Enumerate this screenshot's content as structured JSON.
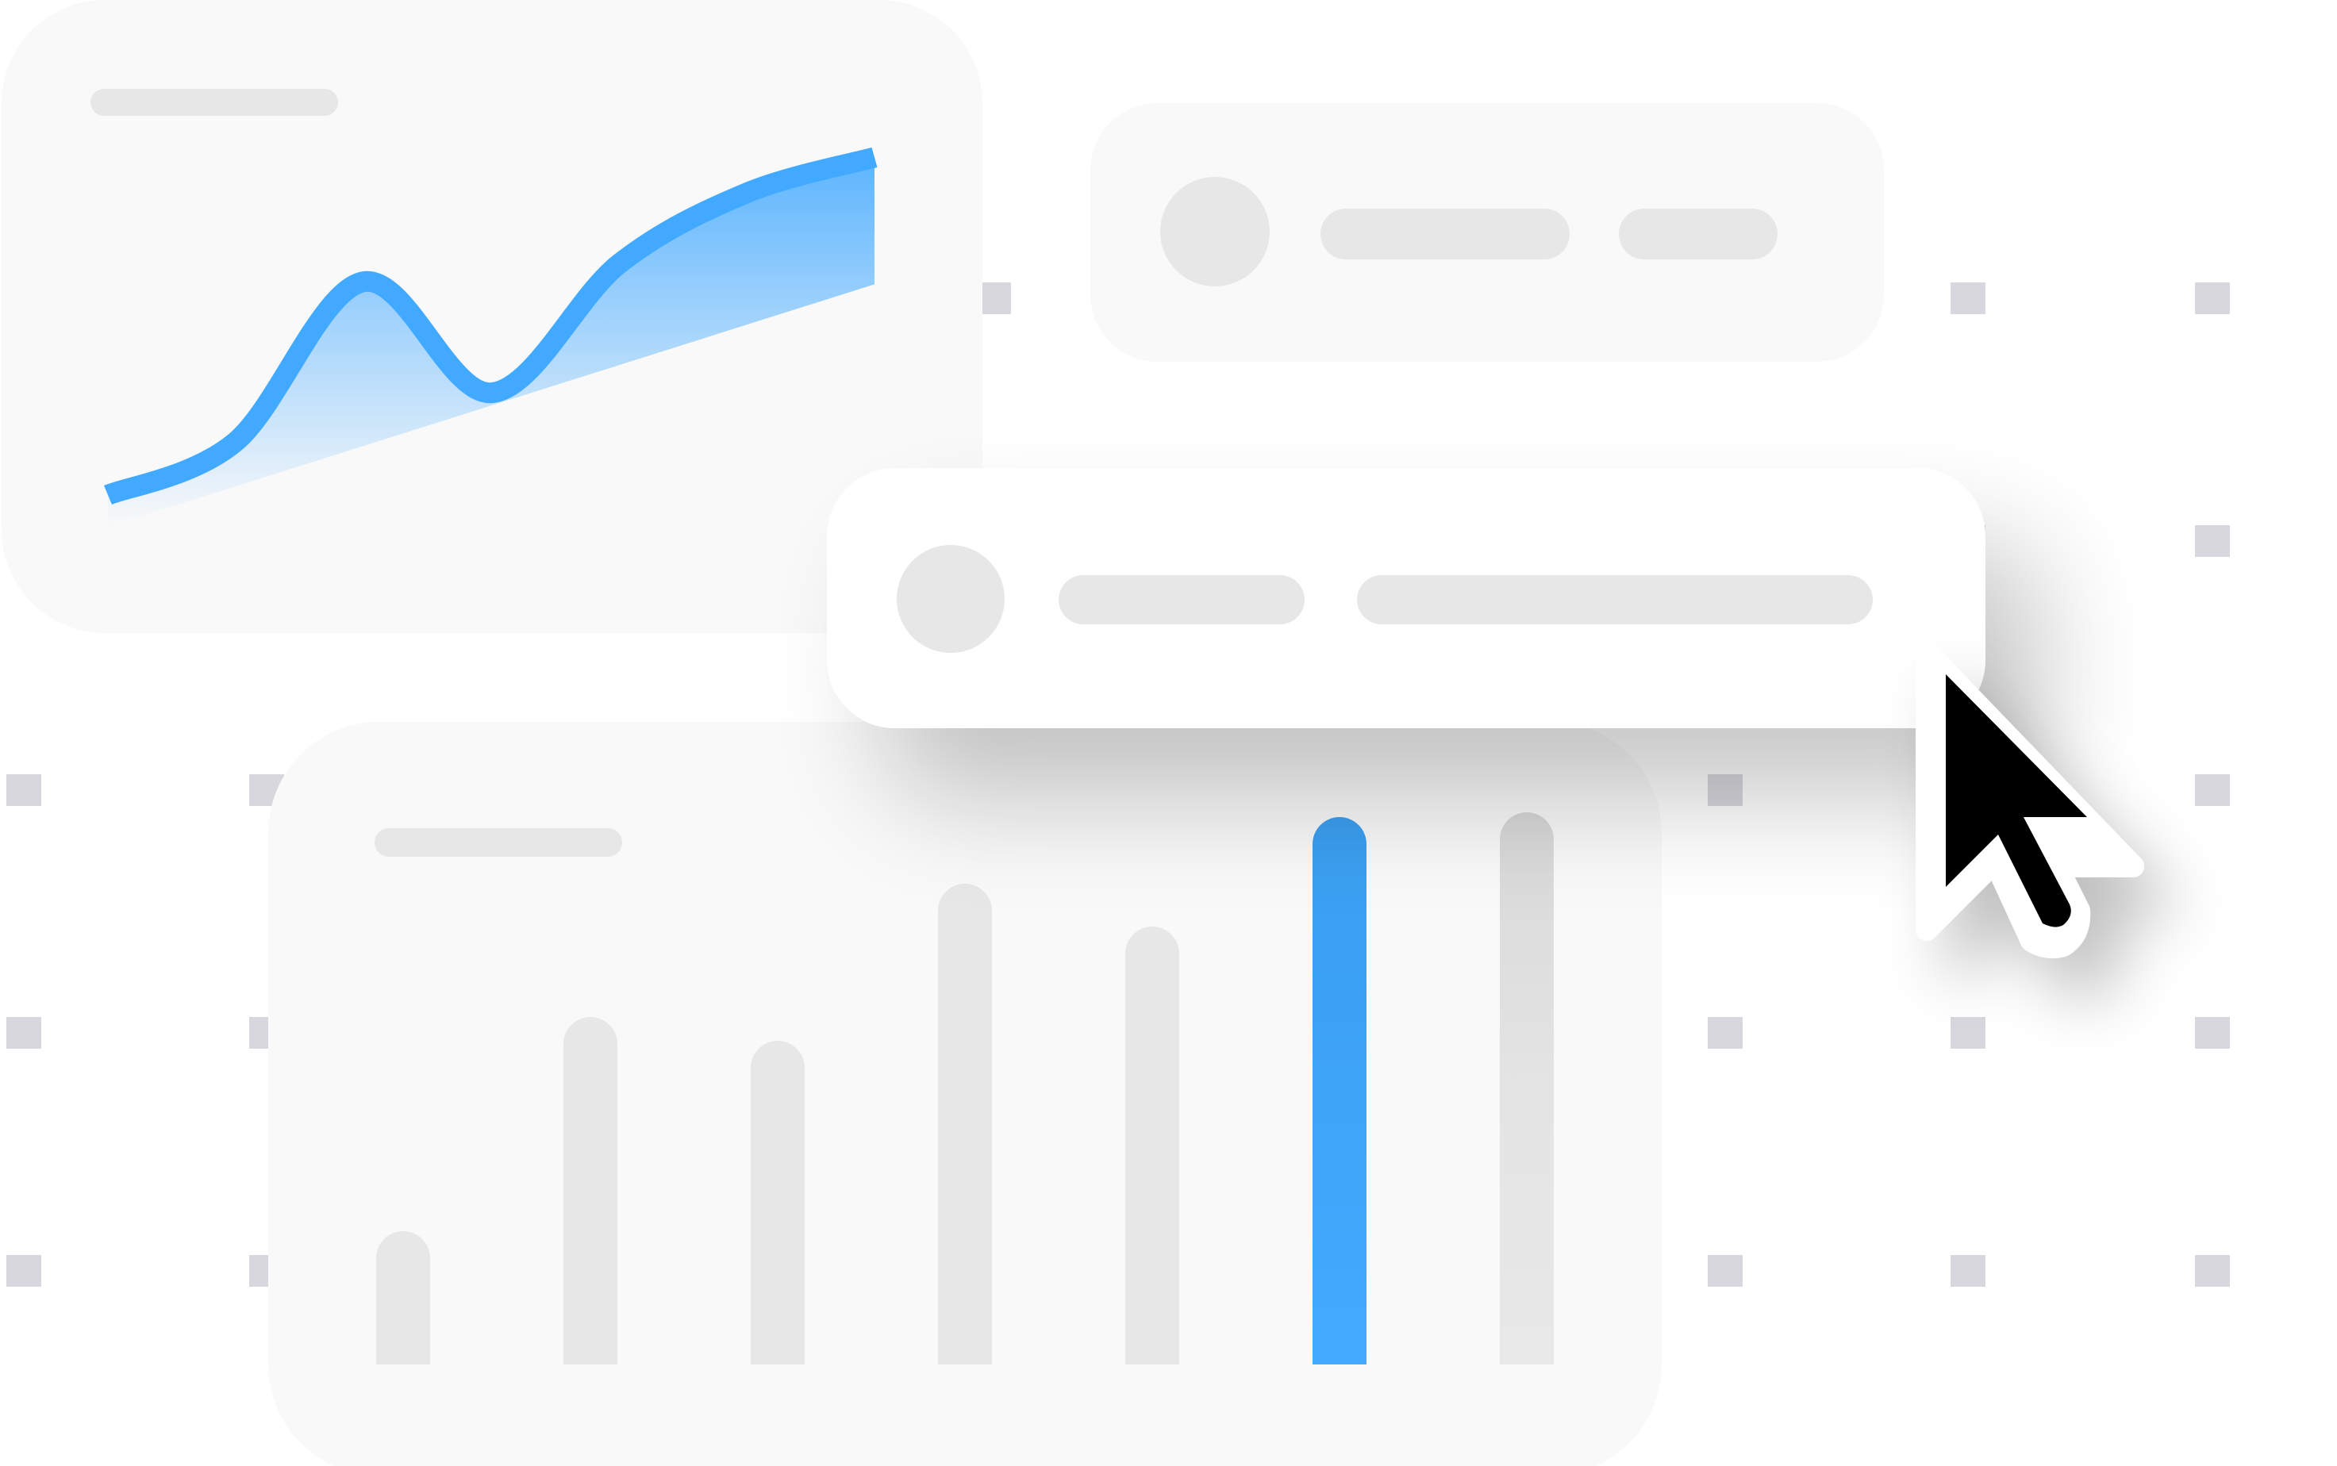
{
  "theme": {
    "background": "#ffffff",
    "card_fill": "#f9f9f9",
    "card_fill_front": "#ffffff",
    "placeholder": "#e7e7e7",
    "placeholder_dark": "#d7d7d7",
    "dot": "#d8d7dd",
    "accent": "#41a9ff",
    "accent_dark": "#3aa2ef",
    "cursor_fill": "#000000",
    "cursor_outline": "#ffffff"
  },
  "line_card": {
    "icon": "line-chart-illustration",
    "chart_data": {
      "type": "line",
      "x": [
        0,
        1,
        2,
        3,
        4,
        5,
        6
      ],
      "values": [
        10,
        22,
        58,
        33,
        62,
        78,
        86
      ],
      "ylim": [
        0,
        100
      ],
      "grid": false,
      "legend": "none",
      "color": "#41a9ff"
    }
  },
  "list_card_back": {
    "icon": "avatar-placeholder"
  },
  "list_card_front": {
    "icon": "avatar-placeholder"
  },
  "bar_card": {
    "icon": "bar-chart-illustration",
    "chart_data": {
      "type": "bar",
      "values": [
        28,
        73,
        68,
        101,
        92,
        115,
        116
      ],
      "highlighted_index": 5,
      "ylim": [
        0,
        120
      ],
      "grid": false,
      "legend": "none",
      "bar_colors": [
        "#e7e7e7",
        "#e7e7e7",
        "#e7e7e7",
        "#e7e7e7",
        "#e7e7e7",
        "#41a9ff",
        "#e2e2e2"
      ]
    }
  },
  "cursor": {
    "icon": "mouse-pointer-icon"
  }
}
